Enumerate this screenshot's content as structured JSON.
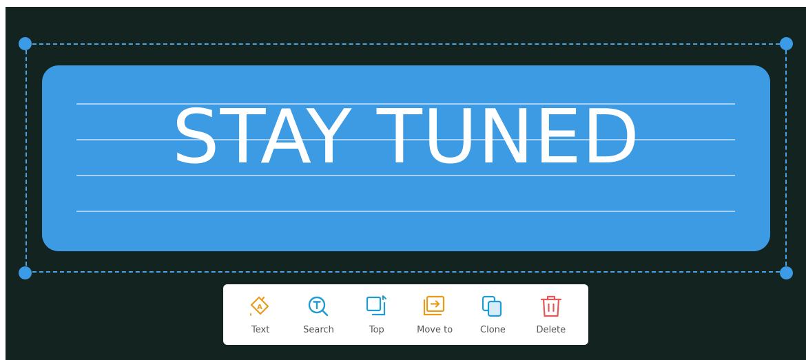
{
  "note": {
    "text": "STAY TUNED",
    "background_color": "#3c9be3",
    "text_color": "#ffffff"
  },
  "canvas": {
    "background_color": "#13231f",
    "selection_color": "#3c9be6"
  },
  "toolbar": {
    "items": [
      {
        "label": "Text",
        "icon": "text-style-icon",
        "color": "#e89b1a"
      },
      {
        "label": "Search",
        "icon": "search-text-icon",
        "color": "#1f9bd1"
      },
      {
        "label": "Top",
        "icon": "bring-to-top-icon",
        "color": "#1f9bd1"
      },
      {
        "label": "Move to",
        "icon": "move-to-icon",
        "color": "#e89b1a"
      },
      {
        "label": "Clone",
        "icon": "clone-icon",
        "color": "#1f9bd1"
      },
      {
        "label": "Delete",
        "icon": "delete-icon",
        "color": "#e05a5a"
      }
    ]
  }
}
